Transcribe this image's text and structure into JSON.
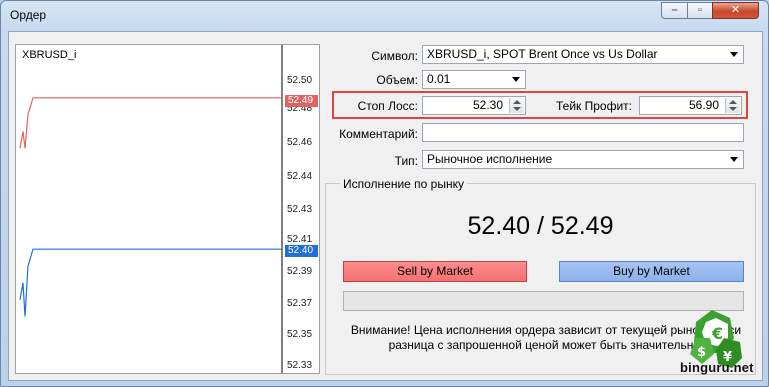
{
  "window": {
    "title": "Ордер",
    "colors": {
      "ask": "#e16464",
      "bid": "#1f6fd6",
      "highlight": "#e04545"
    }
  },
  "chart": {
    "symbol_label": "XBRUSD_i",
    "price_ticks": [
      "52.50",
      "52.48",
      "52.46",
      "52.44",
      "52.43",
      "52.41",
      "52.39",
      "52.37",
      "52.35",
      "52.33"
    ],
    "ask_tag": "52.49",
    "bid_tag": "52.40"
  },
  "chart_data": {
    "type": "line",
    "title": "XBRUSD_i",
    "series": [
      {
        "values": [
          52.46,
          52.47,
          52.46,
          52.48,
          52.49,
          52.49,
          52.49,
          52.49
        ]
      },
      {
        "values": [
          52.37,
          52.38,
          52.36,
          52.39,
          52.4,
          52.4,
          52.4,
          52.4
        ]
      }
    ],
    "ylim": [
      52.33,
      52.5
    ],
    "grid": false
  },
  "form": {
    "symbol_label": "Символ:",
    "symbol_value": "XBRUSD_i, SPOT Brent Once vs Us Dollar",
    "volume_label": "Объем:",
    "volume_value": "0.01",
    "stoploss_label": "Стоп Лосс:",
    "stoploss_value": "52.30",
    "takeprofit_label": "Тейк Профит:",
    "takeprofit_value": "56.90",
    "comment_label": "Комментарий:",
    "comment_value": "",
    "type_label": "Тип:",
    "type_value": "Рыночное исполнение"
  },
  "market": {
    "group_title": "Исполнение по рынку",
    "quote": "52.40 / 52.49",
    "sell_label": "Sell by Market",
    "buy_label": "Buy by Market",
    "warning_line1": "Внимание! Цена исполнения ордера зависит от текущей рыночной си",
    "warning_line2": "разница с запрошенной ценой может быть значительна!"
  },
  "watermark": {
    "text": "binguru.net"
  }
}
